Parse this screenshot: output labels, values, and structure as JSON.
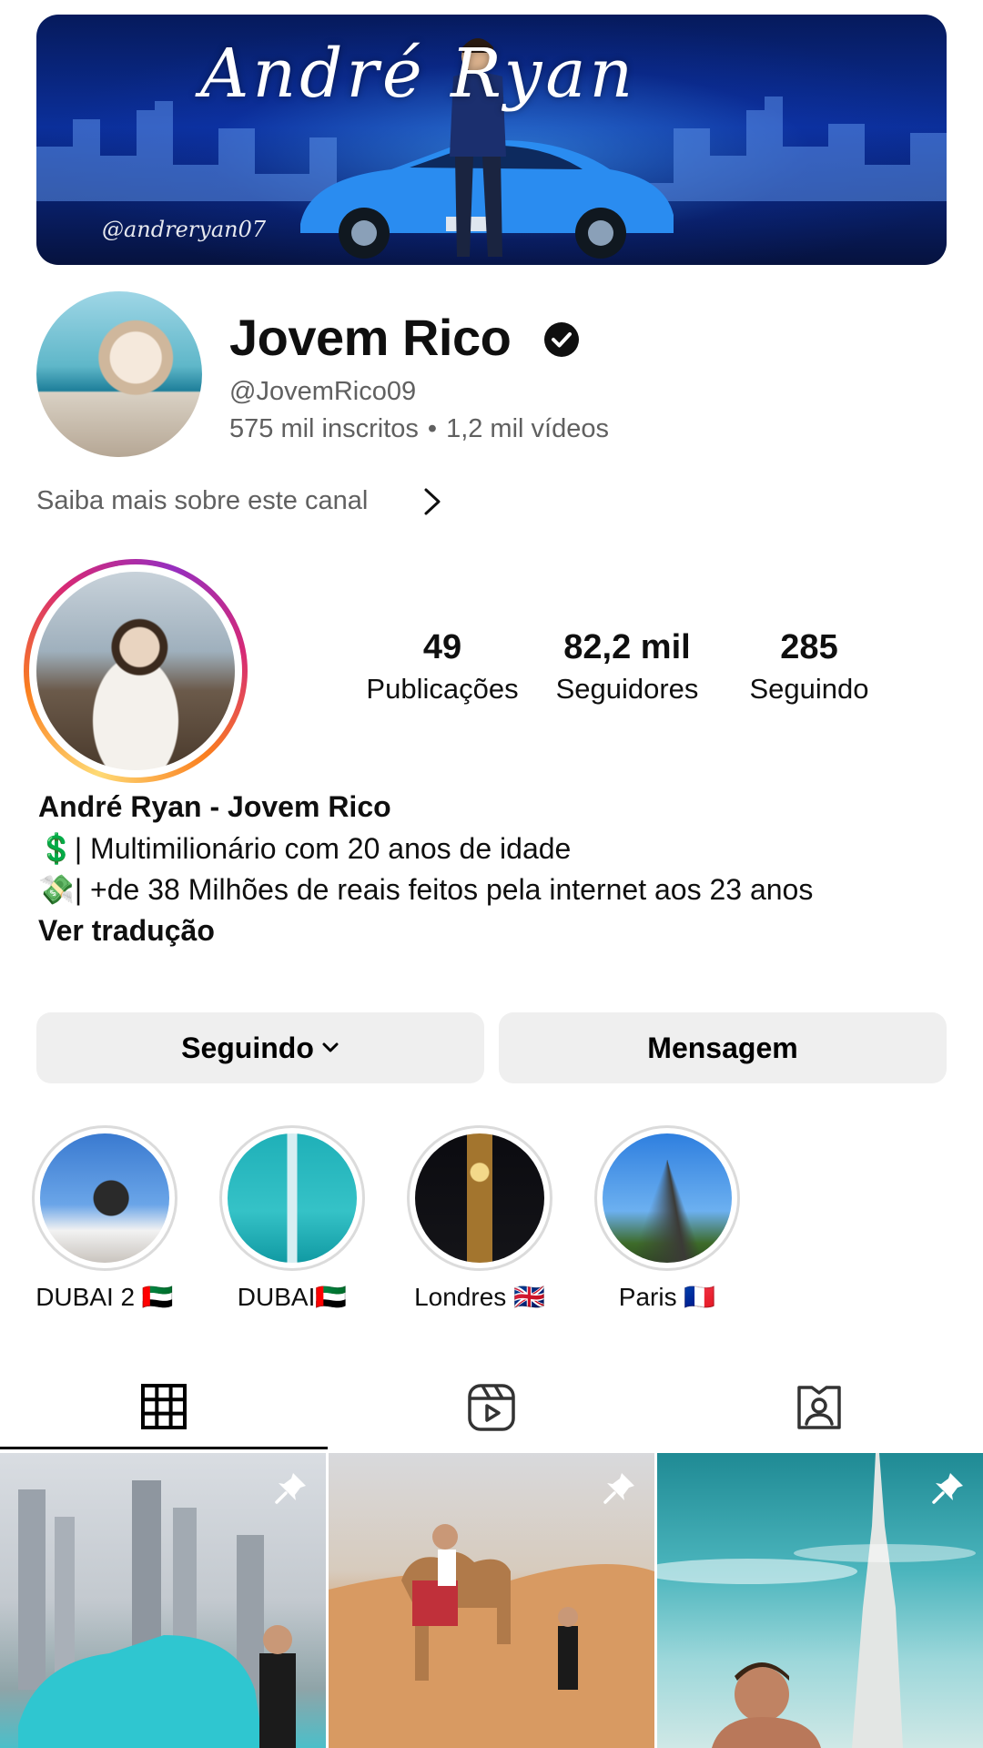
{
  "banner": {
    "title": "André Ryan",
    "handle": "@andreryan07"
  },
  "channel": {
    "name": "Jovem Rico",
    "handle": "@JovemRico09",
    "subscribers": "575 mil inscritos",
    "separator": "•",
    "videos": "1,2 mil vídeos",
    "about_link": "Saiba mais sobre este canal"
  },
  "profile": {
    "stats": {
      "posts_value": "49",
      "posts_label": "Publicações",
      "followers_value": "82,2 mil",
      "followers_label": "Seguidores",
      "following_value": "285",
      "following_label": "Seguindo"
    },
    "bio": {
      "name": "André Ryan - Jovem Rico",
      "line1": "💲| Multimilionário com 20 anos de idade",
      "line2": "💸| +de 38 Milhões de reais feitos pela internet aos 23 anos",
      "translate": "Ver tradução"
    },
    "buttons": {
      "following": "Seguindo",
      "message": "Mensagem"
    }
  },
  "highlights": [
    {
      "label": "DUBAI 2 🇦🇪"
    },
    {
      "label": "DUBAI🇦🇪"
    },
    {
      "label": "Londres 🇬🇧"
    },
    {
      "label": "Paris 🇫🇷"
    }
  ],
  "tabs": {
    "active": "grid"
  },
  "icons": {
    "verified": "verified-check-icon",
    "chevron": "chevron-right-icon",
    "grid": "grid-icon",
    "reels": "reels-icon",
    "tagged": "tagged-icon",
    "pin": "pin-icon"
  },
  "colors": {
    "accent_ring_start": "#feda75",
    "accent_ring_mid": "#d62976",
    "secondary_text": "#606060",
    "button_bg": "#efefef"
  }
}
